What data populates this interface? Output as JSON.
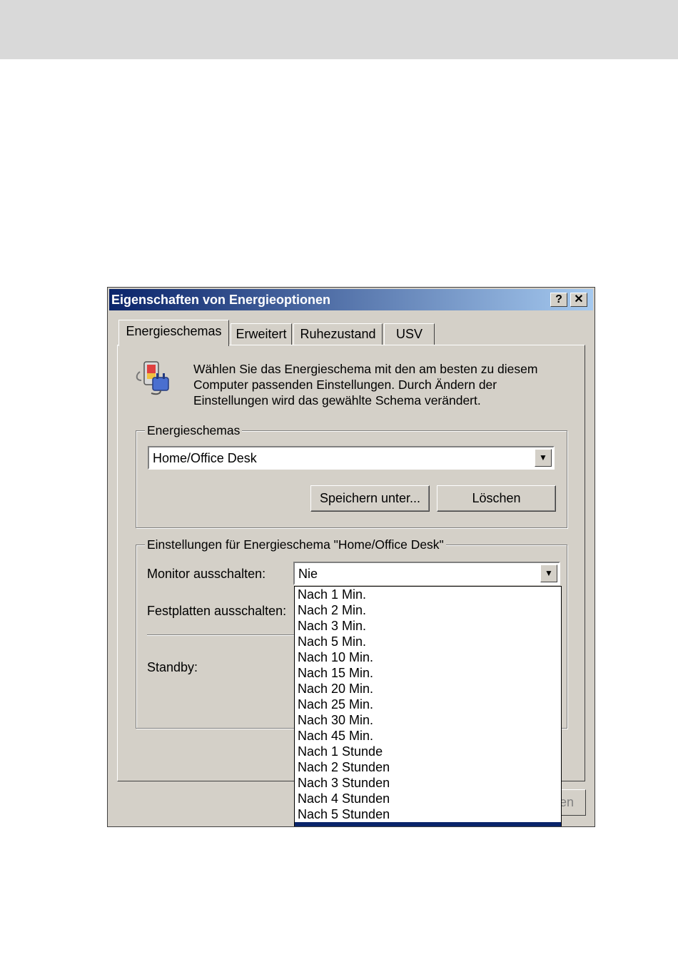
{
  "window": {
    "title": "Eigenschaften von Energieoptionen",
    "help_glyph": "?",
    "close_glyph": "✕"
  },
  "tabs": [
    {
      "label": "Energieschemas",
      "active": true
    },
    {
      "label": "Erweitert",
      "active": false
    },
    {
      "label": "Ruhezustand",
      "active": false
    },
    {
      "label": "USV",
      "active": false
    }
  ],
  "intro": {
    "icon": "power-options-icon",
    "text": "Wählen Sie das Energieschema mit den am besten zu diesem Computer passenden Einstellungen. Durch Ändern der Einstellungen wird das gewählte Schema verändert."
  },
  "schemes_group": {
    "label": "Energieschemas",
    "selected_scheme": "Home/Office Desk",
    "save_as_button": "Speichern unter...",
    "delete_button": "Löschen"
  },
  "settings_group": {
    "label": "Einstellungen für Energieschema \"Home/Office Desk\"",
    "monitor_label": "Monitor ausschalten:",
    "monitor_value": "Nie",
    "harddisk_label": "Festplatten ausschalten:",
    "standby_label": "Standby:"
  },
  "monitor_dropdown": {
    "options": [
      "Nach 1 Min.",
      "Nach 2 Min.",
      "Nach 3 Min.",
      "Nach 5 Min.",
      "Nach 10 Min.",
      "Nach 15 Min.",
      "Nach 20 Min.",
      "Nach 25 Min.",
      "Nach 30 Min.",
      "Nach 45 Min.",
      "Nach 1 Stunde",
      "Nach 2 Stunden",
      "Nach 3 Stunden",
      "Nach 4 Stunden",
      "Nach 5 Stunden"
    ]
  },
  "footer": {
    "partial_button_text": "en"
  },
  "colors": {
    "dialog_bg": "#d4d0c8",
    "titlebar_start": "#0a246a",
    "titlebar_end": "#a6caf0",
    "selection": "#0a246a"
  }
}
